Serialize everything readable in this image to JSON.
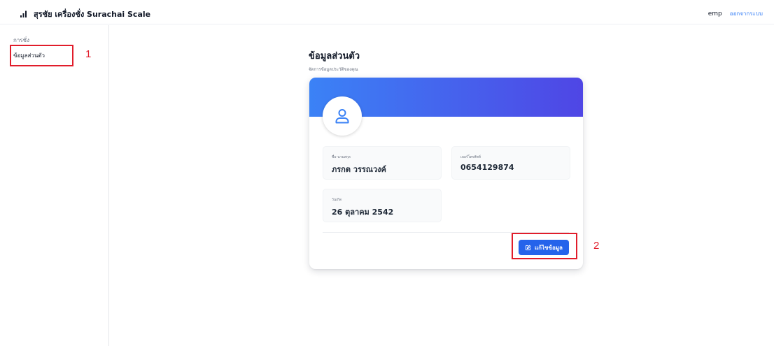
{
  "header": {
    "title": "สุรชัย เครื่องชั่ง Surachai Scale",
    "brand_icon": "bar-chart-icon",
    "username": "emp",
    "logout_label": "ออกจากระบบ"
  },
  "sidebar": {
    "items": [
      {
        "label": "การชั่ง",
        "active": false
      },
      {
        "label": "ข้อมูลส่วนตัว",
        "active": true
      }
    ]
  },
  "page": {
    "title": "ข้อมูลส่วนตัว",
    "subtitle": "จัดการข้อมูลประวัติของคุณ"
  },
  "profile": {
    "avatar_icon": "user-icon",
    "fields": [
      {
        "label": "ชื่อ-นามสกุล",
        "value": "ภรกต วรรณวงค์"
      },
      {
        "label": "เบอร์โทรศัพท์",
        "value": "0654129874"
      },
      {
        "label": "วันเกิด",
        "value": "26 ตุลาคม 2542"
      }
    ],
    "edit_button": {
      "label": "แก้ไขข้อมูล",
      "icon": "edit-icon"
    }
  },
  "annotations": [
    {
      "number": "1",
      "target": "sidebar-item-profile"
    },
    {
      "number": "2",
      "target": "edit-profile-button"
    }
  ],
  "colors": {
    "accent": "#2563eb",
    "banner_start": "#3b82f6",
    "banner_end": "#4f46e5",
    "annotation": "#e11d2b",
    "link": "#3b82f6"
  }
}
